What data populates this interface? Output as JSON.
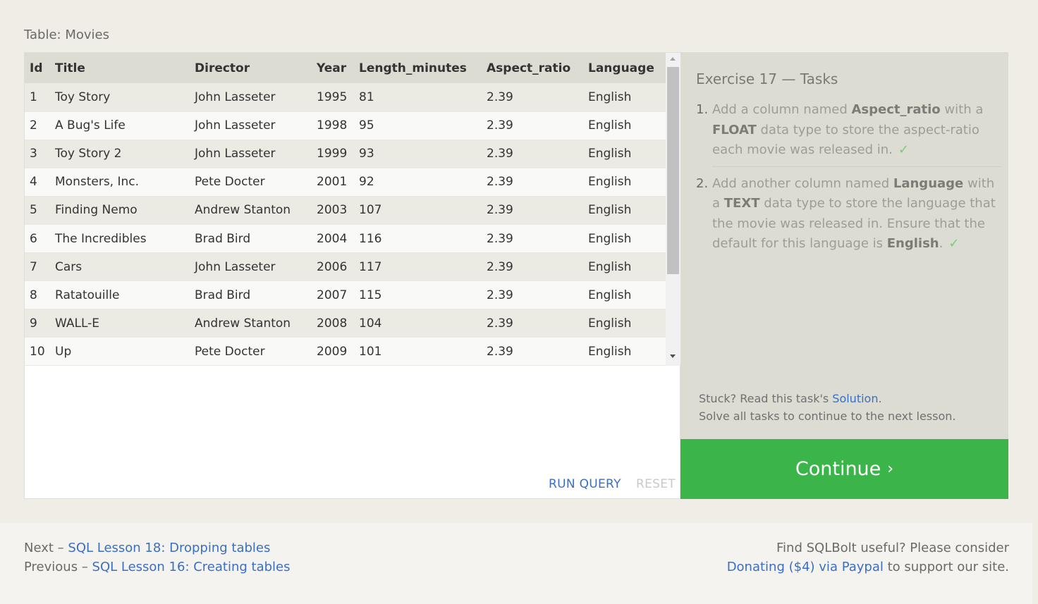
{
  "page": {
    "table_caption": "Table: Movies"
  },
  "table": {
    "columns": [
      "Id",
      "Title",
      "Director",
      "Year",
      "Length_minutes",
      "Aspect_ratio",
      "Language"
    ],
    "rows": [
      [
        "1",
        "Toy Story",
        "John Lasseter",
        "1995",
        "81",
        "2.39",
        "English"
      ],
      [
        "2",
        "A Bug's Life",
        "John Lasseter",
        "1998",
        "95",
        "2.39",
        "English"
      ],
      [
        "3",
        "Toy Story 2",
        "John Lasseter",
        "1999",
        "93",
        "2.39",
        "English"
      ],
      [
        "4",
        "Monsters, Inc.",
        "Pete Docter",
        "2001",
        "92",
        "2.39",
        "English"
      ],
      [
        "5",
        "Finding Nemo",
        "Andrew Stanton",
        "2003",
        "107",
        "2.39",
        "English"
      ],
      [
        "6",
        "The Incredibles",
        "Brad Bird",
        "2004",
        "116",
        "2.39",
        "English"
      ],
      [
        "7",
        "Cars",
        "John Lasseter",
        "2006",
        "117",
        "2.39",
        "English"
      ],
      [
        "8",
        "Ratatouille",
        "Brad Bird",
        "2007",
        "115",
        "2.39",
        "English"
      ],
      [
        "9",
        "WALL-E",
        "Andrew Stanton",
        "2008",
        "104",
        "2.39",
        "English"
      ],
      [
        "10",
        "Up",
        "Pete Docter",
        "2009",
        "101",
        "2.39",
        "English"
      ]
    ]
  },
  "query_actions": {
    "run_label": "RUN QUERY",
    "reset_label": "RESET"
  },
  "tasks": {
    "title": "Exercise 17 — Tasks",
    "items": [
      {
        "number": "1.",
        "t1": "Add a column named ",
        "b1": "Aspect_ratio",
        "t2": " with a ",
        "b2": "FLOAT",
        "t3": " data type to store the aspect-ratio each movie was released in.",
        "check": "✓"
      },
      {
        "number": "2.",
        "t1": "Add another column named ",
        "b1": "Language",
        "t2": " with a ",
        "b2": "TEXT",
        "t3": " data type to store the language that the movie was released in. Ensure that the default for this language is ",
        "b3": "English",
        "t4": ".",
        "check": "✓"
      }
    ],
    "stuck_text": "Stuck? Read this task's ",
    "solution_link": "Solution",
    "stuck_end": ".",
    "solve_text": "Solve all tasks to continue to the next lesson."
  },
  "continue": {
    "label": "Continue",
    "chevron": "›"
  },
  "footer": {
    "next_prefix": "Next – ",
    "next_link": "SQL Lesson 18: Dropping tables",
    "prev_prefix": "Previous – ",
    "prev_link": "SQL Lesson 16: Creating tables",
    "donate_text": "Find SQLBolt useful? Please consider",
    "donate_link": "Donating ($4) via Paypal",
    "donate_suffix": " to support our site."
  },
  "colors": {
    "accent_green": "#3bb54a",
    "link_blue": "#3a6fc2",
    "check_green": "#6fcf7a"
  }
}
